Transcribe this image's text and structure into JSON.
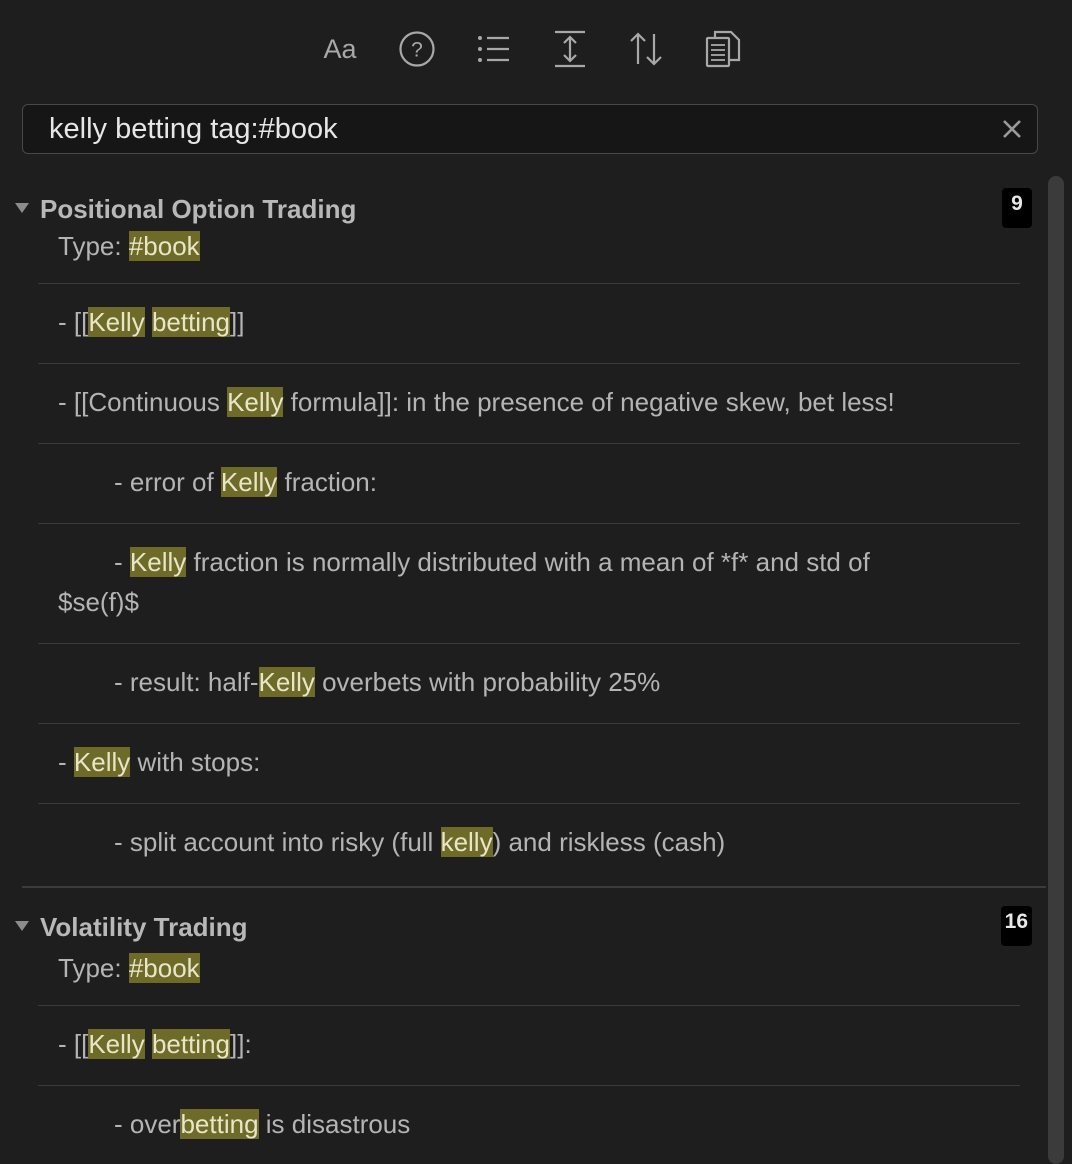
{
  "toolbar": {
    "buttons": [
      {
        "name": "match-case-icon",
        "label": "Aa"
      },
      {
        "name": "help-icon",
        "label": "?"
      },
      {
        "name": "list-icon"
      },
      {
        "name": "expand-icon"
      },
      {
        "name": "sort-icon"
      },
      {
        "name": "copy-results-icon"
      }
    ]
  },
  "search": {
    "value": "kelly betting tag:#book",
    "clear_icon": "close-icon"
  },
  "results": {
    "groups": [
      {
        "title": "Positional Option Trading",
        "count": "9",
        "matches": [
          [
            "Type: ",
            "#book"
          ],
          [
            "- [[",
            "Kelly",
            " ",
            "betting",
            "]]"
          ],
          [
            "- [[Continuous ",
            "Kelly",
            " formula]]: in the presence of negative skew, bet less!"
          ],
          [
            "- error of ",
            "Kelly",
            " fraction:"
          ],
          [
            "- ",
            "Kelly",
            " fraction is normally distributed with a mean of *f* and std of $se(f)$"
          ],
          [
            "- result: half-",
            "Kelly",
            " overbets with probability 25%"
          ],
          [
            "- ",
            "Kelly",
            " with stops:"
          ],
          [
            "- split account into risky (full ",
            "kelly",
            ") and riskless (cash)"
          ]
        ]
      },
      {
        "title": "Volatility Trading",
        "count": "16",
        "matches": [
          [
            "Type: ",
            "#book"
          ],
          [
            "- [[",
            "Kelly",
            " ",
            "betting",
            "]]:"
          ],
          [
            "- over",
            "betting",
            " is disastrous"
          ]
        ]
      }
    ]
  },
  "colors": {
    "background": "#1e1e1e",
    "highlight": "#6e6a28",
    "badge": "#000000"
  }
}
